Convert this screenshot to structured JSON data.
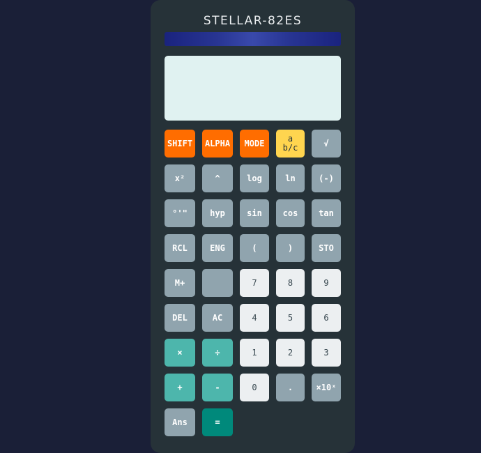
{
  "calculator": {
    "brand": "STELLAR-82ES",
    "display": {
      "text": ""
    },
    "keys": [
      [
        "SHIFT",
        "ALPHA",
        "MODE",
        "a b/c",
        "√"
      ],
      [
        "x²",
        "^",
        "log",
        "ln",
        "(-)"
      ],
      [
        "°'\"",
        "hyp",
        "sin",
        "cos",
        "tan"
      ],
      [
        "RCL",
        "ENG",
        "(",
        ")",
        "STO"
      ],
      [
        "M+",
        "",
        "7",
        "8",
        "9"
      ],
      [
        "DEL",
        "AC",
        "4",
        "5",
        "6"
      ],
      [
        "×",
        "÷",
        "1",
        "2",
        "3"
      ],
      [
        "+",
        "-",
        "0",
        ".",
        "×10ˣ"
      ],
      [
        "Ans",
        "="
      ]
    ],
    "fraction_key": {
      "top": "a",
      "bottom": "b/c"
    }
  },
  "colors": {
    "background": "#1a1f37",
    "body": "#263238",
    "display": "#e0f2f1",
    "shift": "#ff6d00",
    "fraction": "#ffd54f",
    "function": "#90a4ae",
    "digit": "#eceff1",
    "operator": "#4db6ac",
    "equals": "#00897b"
  }
}
